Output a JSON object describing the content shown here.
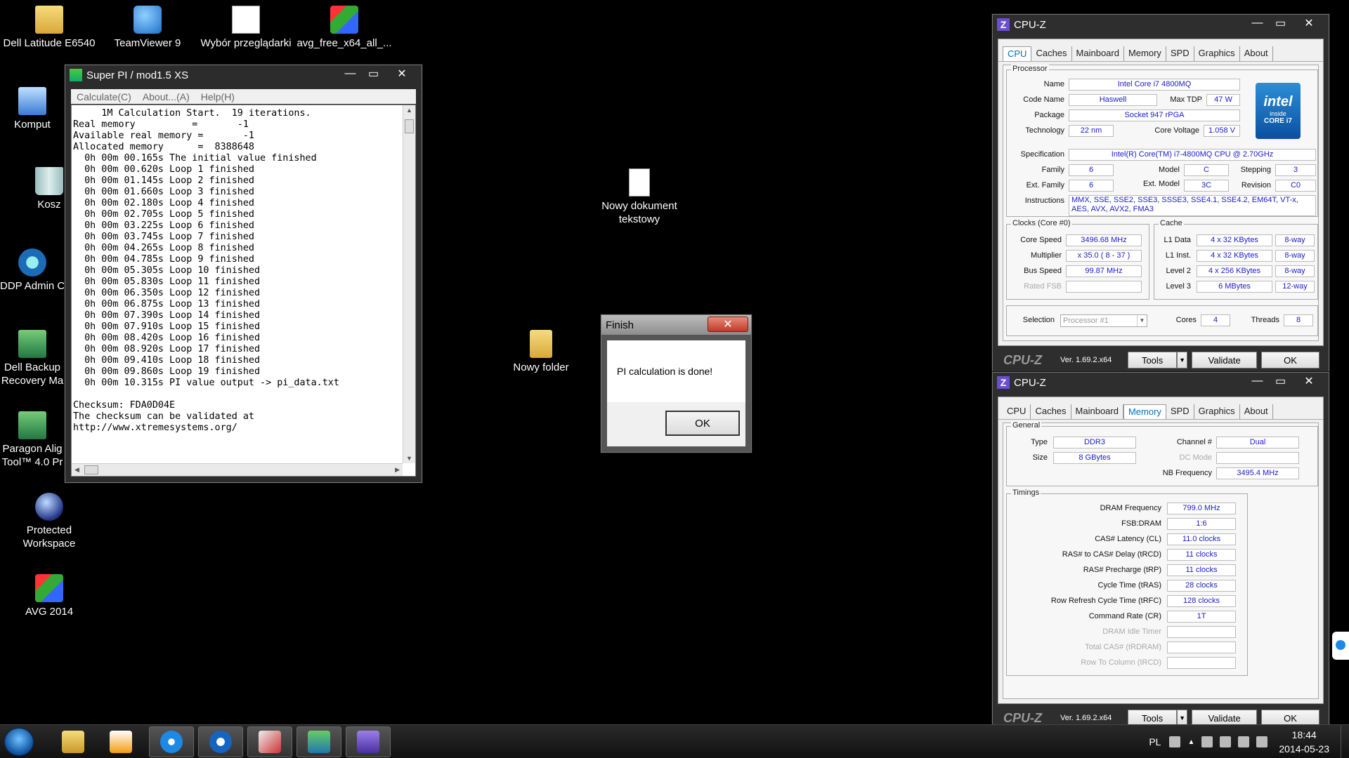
{
  "desktop": {
    "icons": [
      {
        "label": "Dell Latitude E6540",
        "icon": "folder-icon"
      },
      {
        "label": "TeamViewer 9",
        "icon": "teamviewer-icon"
      },
      {
        "label": "Wybór przeglądarki",
        "icon": "browser-choice-icon"
      },
      {
        "label": "avg_free_x64_all_...",
        "icon": "avg-installer-icon"
      },
      {
        "label": "Komput",
        "icon": "computer-icon"
      },
      {
        "label": "Kosz",
        "icon": "recycle-bin-icon"
      },
      {
        "label": "DDP Admin C",
        "icon": "lock-icon"
      },
      {
        "label": "Dell Backup Recovery Ma",
        "icon": "backup-icon"
      },
      {
        "label": "Paragon Alig Tool™ 4.0 Pr",
        "icon": "paragon-icon"
      },
      {
        "label": "Protected Workspace",
        "icon": "globe-lock-icon"
      },
      {
        "label": "AVG 2014",
        "icon": "avg-icon"
      },
      {
        "label": "Nowy dokument tekstowy",
        "icon": "text-document-icon"
      },
      {
        "label": "Nowy folder",
        "icon": "folder-icon"
      }
    ]
  },
  "superpi": {
    "title": "Super PI / mod1.5 XS",
    "menu": [
      "Calculate(C)",
      "About...(A)",
      "Help(H)"
    ],
    "output": "     1M Calculation Start.  19 iterations.\nReal memory          =       -1\nAvailable real memory =       -1\nAllocated memory      =  8388648\n  0h 00m 00.165s The initial value finished\n  0h 00m 00.620s Loop 1 finished\n  0h 00m 01.145s Loop 2 finished\n  0h 00m 01.660s Loop 3 finished\n  0h 00m 02.180s Loop 4 finished\n  0h 00m 02.705s Loop 5 finished\n  0h 00m 03.225s Loop 6 finished\n  0h 00m 03.745s Loop 7 finished\n  0h 00m 04.265s Loop 8 finished\n  0h 00m 04.785s Loop 9 finished\n  0h 00m 05.305s Loop 10 finished\n  0h 00m 05.830s Loop 11 finished\n  0h 00m 06.350s Loop 12 finished\n  0h 00m 06.875s Loop 13 finished\n  0h 00m 07.390s Loop 14 finished\n  0h 00m 07.910s Loop 15 finished\n  0h 00m 08.420s Loop 16 finished\n  0h 00m 08.920s Loop 17 finished\n  0h 00m 09.410s Loop 18 finished\n  0h 00m 09.860s Loop 19 finished\n  0h 00m 10.315s PI value output -> pi_data.txt\n\nChecksum: FDA0D04E\nThe checksum can be validated at\nhttp://www.xtremesystems.org/"
  },
  "finish_dialog": {
    "title": "Finish",
    "message": "PI calculation is done!",
    "ok_label": "OK"
  },
  "cpuz_cpu": {
    "title": "CPU-Z",
    "tabs": [
      "CPU",
      "Caches",
      "Mainboard",
      "Memory",
      "SPD",
      "Graphics",
      "About"
    ],
    "active_tab": "CPU",
    "processor_label": "Processor",
    "name_label": "Name",
    "name": "Intel Core i7 4800MQ",
    "codename_label": "Code Name",
    "codename": "Haswell",
    "maxtdp_label": "Max TDP",
    "maxtdp": "47 W",
    "package_label": "Package",
    "package": "Socket 947 rPGA",
    "technology_label": "Technology",
    "technology": "22 nm",
    "corevoltage_label": "Core Voltage",
    "corevoltage": "1.058 V",
    "spec_label": "Specification",
    "spec": "Intel(R) Core(TM) i7-4800MQ CPU @ 2.70GHz",
    "family_label": "Family",
    "family": "6",
    "model_label": "Model",
    "model": "C",
    "stepping_label": "Stepping",
    "stepping": "3",
    "extfamily_label": "Ext. Family",
    "extfamily": "6",
    "extmodel_label": "Ext. Model",
    "extmodel": "3C",
    "revision_label": "Revision",
    "revision": "C0",
    "instructions_label": "Instructions",
    "instructions": "MMX, SSE, SSE2, SSE3, SSSE3, SSE4.1, SSE4.2, EM64T, VT-x, AES, AVX, AVX2, FMA3",
    "intel_logo": {
      "brand": "intel",
      "inside": "inside",
      "series": "CORE i7"
    },
    "clocks_label": "Clocks (Core #0)",
    "corespeed_label": "Core Speed",
    "corespeed": "3496.68 MHz",
    "multiplier_label": "Multiplier",
    "multiplier": "x 35.0 ( 8 - 37 )",
    "busspeed_label": "Bus Speed",
    "busspeed": "99.87 MHz",
    "ratedfsb_label": "Rated FSB",
    "ratedfsb": "",
    "cache_label": "Cache",
    "l1data_label": "L1 Data",
    "l1data": "4 x 32 KBytes",
    "l1data_way": "8-way",
    "l1inst_label": "L1 Inst.",
    "l1inst": "4 x 32 KBytes",
    "l1inst_way": "8-way",
    "level2_label": "Level 2",
    "level2": "4 x 256 KBytes",
    "level2_way": "8-way",
    "level3_label": "Level 3",
    "level3": "6 MBytes",
    "level3_way": "12-way",
    "selection_label": "Selection",
    "selection": "Processor #1",
    "cores_label": "Cores",
    "cores": "4",
    "threads_label": "Threads",
    "threads": "8",
    "logo": "CPU-Z",
    "version": "Ver. 1.69.2.x64",
    "tools_label": "Tools",
    "validate_label": "Validate",
    "ok_label": "OK"
  },
  "cpuz_mem": {
    "title": "CPU-Z",
    "tabs": [
      "CPU",
      "Caches",
      "Mainboard",
      "Memory",
      "SPD",
      "Graphics",
      "About"
    ],
    "active_tab": "Memory",
    "general_label": "General",
    "type_label": "Type",
    "type": "DDR3",
    "size_label": "Size",
    "size": "8 GBytes",
    "channel_label": "Channel #",
    "channel": "Dual",
    "dcmode_label": "DC Mode",
    "dcmode": "",
    "nbfreq_label": "NB Frequency",
    "nbfreq": "3495.4 MHz",
    "timings_label": "Timings",
    "timings": [
      {
        "label": "DRAM Frequency",
        "value": "799.0 MHz",
        "disabled": false
      },
      {
        "label": "FSB:DRAM",
        "value": "1:6",
        "disabled": false
      },
      {
        "label": "CAS# Latency (CL)",
        "value": "11.0 clocks",
        "disabled": false
      },
      {
        "label": "RAS# to CAS# Delay (tRCD)",
        "value": "11 clocks",
        "disabled": false
      },
      {
        "label": "RAS# Precharge (tRP)",
        "value": "11 clocks",
        "disabled": false
      },
      {
        "label": "Cycle Time (tRAS)",
        "value": "28 clocks",
        "disabled": false
      },
      {
        "label": "Row Refresh Cycle Time (tRFC)",
        "value": "128 clocks",
        "disabled": false
      },
      {
        "label": "Command Rate (CR)",
        "value": "1T",
        "disabled": false
      },
      {
        "label": "DRAM Idle Timer",
        "value": "",
        "disabled": true
      },
      {
        "label": "Total CAS# (tRDRAM)",
        "value": "",
        "disabled": true
      },
      {
        "label": "Row To Column (tRCD)",
        "value": "",
        "disabled": true
      }
    ],
    "logo": "CPU-Z",
    "version": "Ver. 1.69.2.x64",
    "tools_label": "Tools",
    "validate_label": "Validate",
    "ok_label": "OK"
  },
  "taskbar": {
    "language": "PL",
    "time": "18:44",
    "date": "2014-05-23",
    "items": [
      "explorer-icon",
      "media-player-icon",
      "internet-explorer-icon",
      "teamviewer-icon",
      "snipping-tool-icon",
      "superpi-icon",
      "cpuz-icon"
    ]
  }
}
